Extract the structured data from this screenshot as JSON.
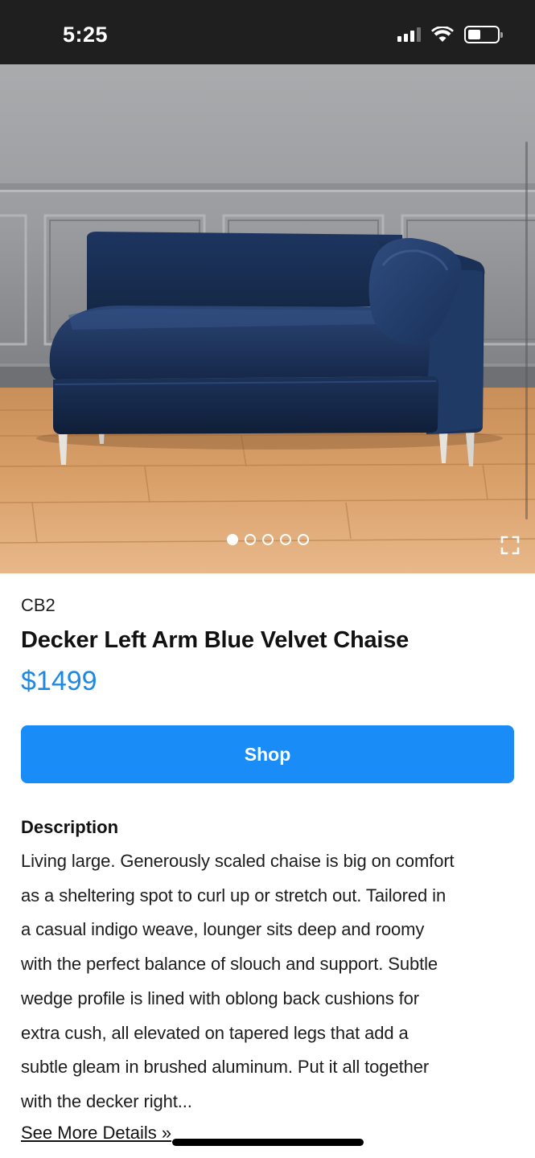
{
  "status_bar": {
    "time": "5:25",
    "icons": [
      "signal-icon",
      "wifi-icon",
      "battery-icon"
    ]
  },
  "hero": {
    "image": "blue-velvet-chaise-photo",
    "carousel": {
      "count": 5,
      "active_index": 0
    },
    "expand_icon": "expand-icon"
  },
  "product": {
    "brand": "CB2",
    "title": "Decker Left Arm Blue Velvet Chaise",
    "price": "$1499",
    "shop_label": "Shop"
  },
  "description": {
    "heading": "Description",
    "lines": [
      "Living large. Generously scaled chaise is big on comfort",
      "as a sheltering spot to curl up or stretch out. Tailored in",
      "a casual indigo weave, lounger sits deep and roomy",
      "with the perfect balance of slouch and support. Subtle",
      "wedge profile is lined with oblong back cushions for",
      "extra cush, all elevated on tapered legs that add a",
      "subtle gleam in brushed aluminum. Put it all together",
      "with the decker right..."
    ],
    "see_more": "See More Details »"
  },
  "colors": {
    "accent": "#1a8cf7",
    "price": "#1e88e5",
    "status_bar": "#1f1f1f"
  }
}
